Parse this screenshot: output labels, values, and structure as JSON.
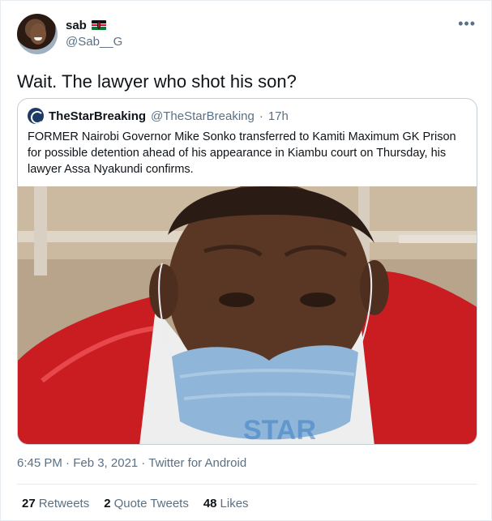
{
  "author": {
    "display_name": "sab",
    "handle": "@Sab__G",
    "flag_icon": "kenya-flag-icon"
  },
  "tweet": {
    "text": "Wait. The lawyer who shot his son?",
    "timestamp": "6:45 PM · Feb 3, 2021 · Twitter for Android"
  },
  "quoted": {
    "name": "TheStarBreaking",
    "handle": "@TheStarBreaking",
    "separator": "·",
    "time": "17h",
    "text": "FORMER Nairobi Governor Mike Sonko transferred to Kamiti Maximum GK Prison for possible detention ahead of his appearance in Kiambu court on Thursday, his lawyer Assa Nyakundi confirms.",
    "watermark": "STAR"
  },
  "stats": {
    "retweets_count": "27",
    "retweets_label": "Retweets",
    "quotes_count": "2",
    "quotes_label": "Quote Tweets",
    "likes_count": "48",
    "likes_label": "Likes"
  },
  "colors": {
    "text_primary": "#0f1419",
    "text_secondary": "#5b7083",
    "border": "#c4cfd6"
  }
}
